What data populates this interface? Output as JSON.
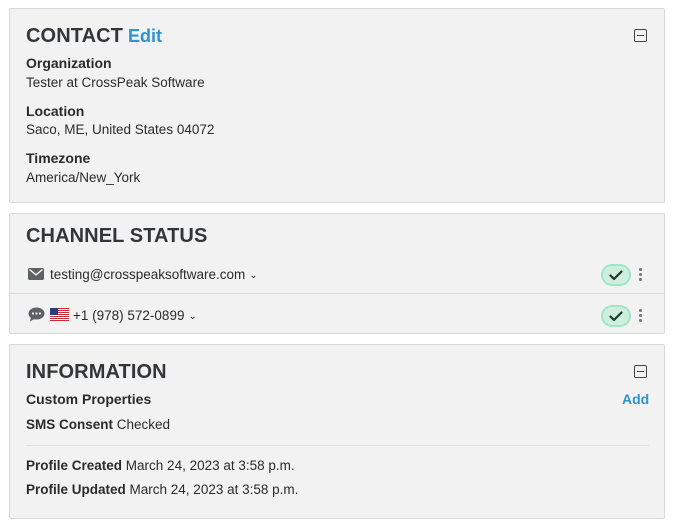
{
  "contact": {
    "title": "CONTACT",
    "edit_label": "Edit",
    "fields": [
      {
        "label": "Organization",
        "value": "Tester at CrossPeak Software"
      },
      {
        "label": "Location",
        "value": "Saco, ME, United States 04072"
      },
      {
        "label": "Timezone",
        "value": "America/New_York"
      }
    ]
  },
  "channel_status": {
    "title": "CHANNEL STATUS",
    "channels": [
      {
        "type": "email",
        "icon": "envelope-icon",
        "value": "testing@crosspeaksoftware.com",
        "status": "check-icon"
      },
      {
        "type": "sms",
        "icon": "chat-bubble-icon",
        "flag": "us-flag-icon",
        "value": "+1 (978) 572-0899",
        "status": "check-icon"
      }
    ]
  },
  "information": {
    "title": "INFORMATION",
    "custom_properties_label": "Custom Properties",
    "add_label": "Add",
    "sms_consent_label": "SMS Consent",
    "sms_consent_value": "Checked",
    "profile_created_label": "Profile Created",
    "profile_created_value": "March 24, 2023 at 3:58 p.m.",
    "profile_updated_label": "Profile Updated",
    "profile_updated_value": "March 24, 2023 at 3:58 p.m."
  },
  "colors": {
    "accent": "#2e93d1",
    "panel_bg": "#f2f2f3",
    "status_green": "#9fe6c4"
  }
}
